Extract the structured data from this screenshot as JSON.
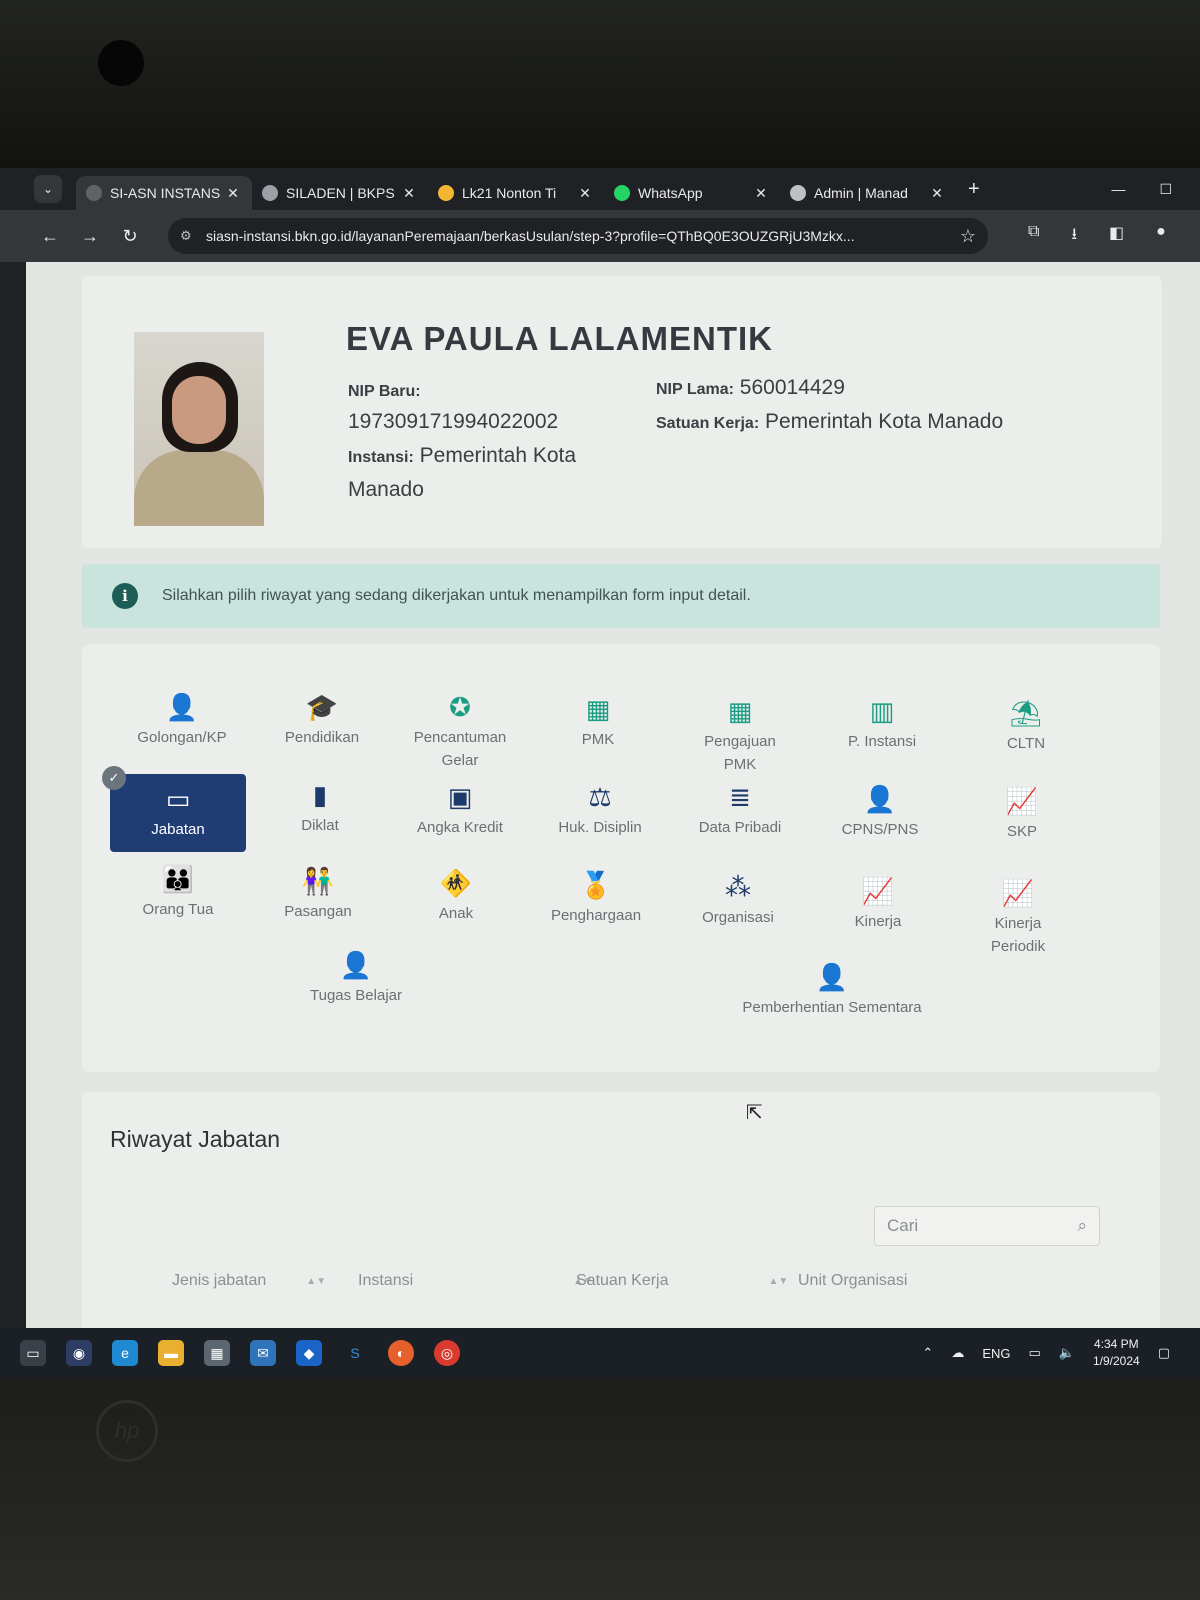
{
  "browser": {
    "tabs": [
      {
        "title": "SI-ASN INSTANS",
        "active": true,
        "favicon_color": "#5f6368"
      },
      {
        "title": "SILADEN | BKPS",
        "active": false,
        "favicon_color": "#9aa0a6"
      },
      {
        "title": "Lk21 Nonton Ti",
        "active": false,
        "favicon_color": "#f2b632"
      },
      {
        "title": "WhatsApp",
        "active": false,
        "favicon_color": "#25d366"
      },
      {
        "title": "Admin | Manad",
        "active": false,
        "favicon_color": "#bdc1c6"
      }
    ],
    "url": "siasn-instansi.bkn.go.id/layananPeremajaan/berkasUsulan/step-3?profile=QThBQ0E3OUZGRjU3Mzkx..."
  },
  "profile": {
    "name": "EVA PAULA LALAMENTIK",
    "nip_baru_label": "NIP Baru:",
    "nip_baru": "197309171994022002",
    "instansi_label": "Instansi:",
    "instansi_line1": "Pemerintah Kota",
    "instansi_line2": "Manado",
    "nip_lama_label": "NIP Lama:",
    "nip_lama": "560014429",
    "satuan_kerja_label": "Satuan Kerja:",
    "satuan_kerja": "Pemerintah Kota Manado"
  },
  "alert": {
    "icon": "info-icon",
    "text": "Silahkan pilih riwayat yang sedang dikerjakan untuk menampilkan form input detail."
  },
  "menu": {
    "golongan": "Golongan/KP",
    "pendidikan": "Pendidikan",
    "pencantuman_1": "Pencantuman",
    "pencantuman_2": "Gelar",
    "pmk": "PMK",
    "pengajuan_1": "Pengajuan",
    "pengajuan_2": "PMK",
    "p_instansi": "P. Instansi",
    "cltn": "CLTN",
    "jabatan": "Jabatan",
    "diklat": "Diklat",
    "angka_kredit": "Angka Kredit",
    "huk_disiplin": "Huk. Disiplin",
    "data_pribadi": "Data Pribadi",
    "cpns_pns": "CPNS/PNS",
    "skp": "SKP",
    "orang_tua": "Orang Tua",
    "pasangan": "Pasangan",
    "anak": "Anak",
    "penghargaan": "Penghargaan",
    "organisasi": "Organisasi",
    "kinerja": "Kinerja",
    "kinerja_periodik_1": "Kinerja",
    "kinerja_periodik_2": "Periodik",
    "tugas_belajar": "Tugas Belajar",
    "pemberhentian": "Pemberhentian Sementara",
    "active_item": "Jabatan",
    "colors": {
      "teal": "#1b9d83",
      "navy": "#1d3a6b",
      "active_bg": "#1f3c73"
    }
  },
  "riwayat": {
    "title": "Riwayat Jabatan",
    "search_placeholder": "Cari",
    "columns": [
      "Jenis jabatan",
      "Instansi",
      "Satuan Kerja",
      "Unit Organisasi"
    ]
  },
  "taskbar": {
    "language": "ENG",
    "time": "4:34 PM",
    "date": "1/9/2024"
  }
}
